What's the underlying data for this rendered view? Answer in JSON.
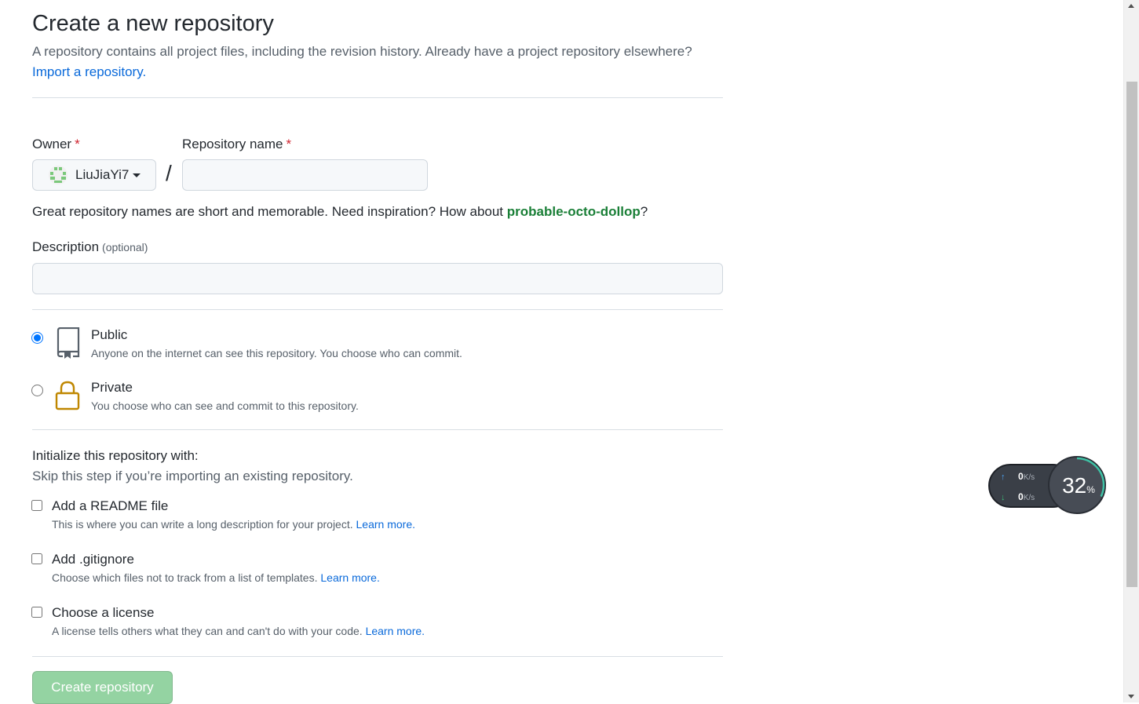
{
  "page": {
    "title": "Create a new repository",
    "subtitle": "A repository contains all project files, including the revision history. Already have a project repository elsewhere?",
    "import_link": "Import a repository."
  },
  "owner": {
    "label": "Owner",
    "required_mark": "*",
    "selected": "LiuJiaYi7"
  },
  "separator": "/",
  "repo_name": {
    "label": "Repository name",
    "required_mark": "*",
    "value": ""
  },
  "name_hint": {
    "prefix": "Great repository names are short and memorable. Need inspiration? How about ",
    "suggestion": "probable-octo-dollop",
    "suffix": "?"
  },
  "description": {
    "label": "Description",
    "optional": "(optional)",
    "value": ""
  },
  "visibility": {
    "options": [
      {
        "label": "Public",
        "desc": "Anyone on the internet can see this repository. You choose who can commit.",
        "icon": "repo-icon",
        "checked": true
      },
      {
        "label": "Private",
        "desc": "You choose who can see and commit to this repository.",
        "icon": "lock-icon",
        "checked": false
      }
    ]
  },
  "init": {
    "heading": "Initialize this repository with:",
    "sub": "Skip this step if you’re importing an existing repository.",
    "options": [
      {
        "label": "Add a README file",
        "desc": "This is where you can write a long description for your project. ",
        "link": "Learn more.",
        "checked": false
      },
      {
        "label": "Add .gitignore",
        "desc": "Choose which files not to track from a list of templates. ",
        "link": "Learn more.",
        "checked": false
      },
      {
        "label": "Choose a license",
        "desc": "A license tells others what they can and can't do with your code. ",
        "link": "Learn more.",
        "checked": false
      }
    ]
  },
  "create_button": "Create repository",
  "net_widget": {
    "upload": "0",
    "download": "0",
    "unit": "K/s",
    "percent": "32",
    "percent_sign": "%",
    "percent_value": 0.32
  },
  "colors": {
    "link": "#0969da",
    "suggestion": "#1a7f37",
    "create_button_disabled": "#94d3a2",
    "lock": "#bf8700"
  }
}
